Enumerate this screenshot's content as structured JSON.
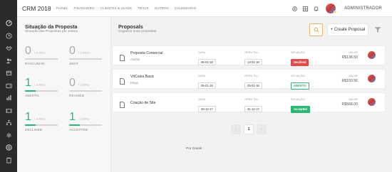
{
  "app": {
    "brand": "CRM 2018"
  },
  "topnav": [
    "PAINEL",
    "FINANCEIRO",
    "CLIENTES & LEADS",
    "TRACK",
    "OUTROS",
    "CALENDÁRIO"
  ],
  "user": {
    "name": "ADMINISTRADOR"
  },
  "sidebar_icons": [
    "dashboard-icon",
    "clock-icon",
    "handshake-icon",
    "users-icon",
    "box-icon",
    "wallet-icon",
    "chart-icon",
    "ticket-icon",
    "tree-icon",
    "fingerprint-icon",
    "lifebuoy-icon",
    "clipboard-icon"
  ],
  "stats_panel": {
    "title": "Situação da Proposta",
    "subtitle": "Situação das Propostas por Status",
    "items": [
      {
        "value": "0",
        "of": "/ 3 PRO",
        "label": "RASCUNHO",
        "progress": 0
      },
      {
        "value": "0",
        "of": "/ 3 PRO",
        "label": "SENT",
        "progress": 0
      },
      {
        "value": "1",
        "of": "/ 3 PRO",
        "label": "ABERTO",
        "progress": 0.33
      },
      {
        "value": "0",
        "of": "/ 3 PRO",
        "label": "REVISED",
        "progress": 0
      },
      {
        "value": "1",
        "of": "/ 3 PRO",
        "label": "DECLINED",
        "progress": 0.33
      },
      {
        "value": "1",
        "of": "/ 3 PRO",
        "label": "ACCEPTED",
        "progress": 0.33
      }
    ]
  },
  "proposals": {
    "title": "Proposals",
    "subtitle": "Organize suas propostas",
    "create_label": "+ Create Proposal",
    "col_data": "DATA",
    "col_open_till": "OPEN TILL",
    "col_situacao": "SITUAÇÃO",
    "col_valor": "VALOR",
    "items": [
      {
        "title": "Proposta Comercial",
        "author": "Andrey",
        "data": "06-01-18",
        "open_till": "13-01-18",
        "status": "Declined",
        "status_type": "declined",
        "valor": "R$138.50"
      },
      {
        "title": "VitCaixa Basic",
        "author": "Diego",
        "data": "05-01-18",
        "open_till": "05-01-18",
        "status": "ABERTO",
        "status_type": "aberto",
        "valor": "R$159.56"
      },
      {
        "title": "Criação de Site",
        "author": "",
        "data": "30-12-17",
        "open_till": "31-12-17",
        "status": "Accepted",
        "status_type": "accepted",
        "valor": "R$568.00"
      }
    ]
  },
  "pagination": {
    "prev": "‹",
    "current": "1",
    "next": "›"
  },
  "footer": {
    "credit": "Por Dasak"
  },
  "colors": {
    "green": "#2bb673",
    "red": "#e04b4b",
    "orange": "#e89a3c",
    "sidebar": "#2b2b2b"
  }
}
